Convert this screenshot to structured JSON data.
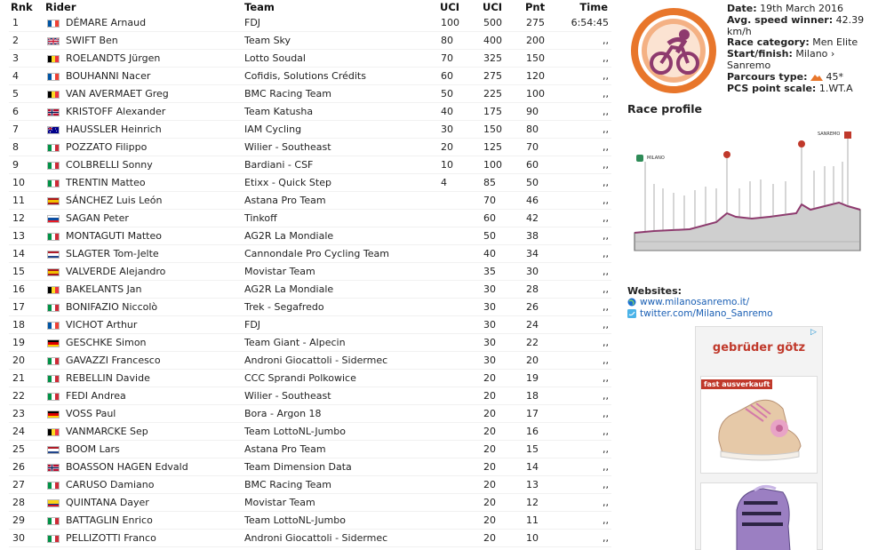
{
  "table": {
    "headers": {
      "rnk": "Rnk",
      "rider": "Rider",
      "team": "Team",
      "uci1": "UCI",
      "uci2": "UCI",
      "pnt": "Pnt",
      "time": "Time"
    },
    "rows": [
      {
        "rnk": "1",
        "flag": "fr",
        "rider": "DÉMARE Arnaud",
        "team": "FDJ",
        "uci1": "100",
        "uci2": "500",
        "pnt": "275",
        "time": "6:54:45"
      },
      {
        "rnk": "2",
        "flag": "gb",
        "rider": "SWIFT Ben",
        "team": "Team Sky",
        "uci1": "80",
        "uci2": "400",
        "pnt": "200",
        "time": ",,"
      },
      {
        "rnk": "3",
        "flag": "be",
        "rider": "ROELANDTS Jürgen",
        "team": "Lotto Soudal",
        "uci1": "70",
        "uci2": "325",
        "pnt": "150",
        "time": ",,"
      },
      {
        "rnk": "4",
        "flag": "fr",
        "rider": "BOUHANNI Nacer",
        "team": "Cofidis, Solutions Crédits",
        "uci1": "60",
        "uci2": "275",
        "pnt": "120",
        "time": ",,"
      },
      {
        "rnk": "5",
        "flag": "be",
        "rider": "VAN AVERMAET Greg",
        "team": "BMC Racing Team",
        "uci1": "50",
        "uci2": "225",
        "pnt": "100",
        "time": ",,"
      },
      {
        "rnk": "6",
        "flag": "no",
        "rider": "KRISTOFF Alexander",
        "team": "Team Katusha",
        "uci1": "40",
        "uci2": "175",
        "pnt": "90",
        "time": ",,"
      },
      {
        "rnk": "7",
        "flag": "au",
        "rider": "HAUSSLER Heinrich",
        "team": "IAM Cycling",
        "uci1": "30",
        "uci2": "150",
        "pnt": "80",
        "time": ",,"
      },
      {
        "rnk": "8",
        "flag": "it",
        "rider": "POZZATO Filippo",
        "team": "Wilier - Southeast",
        "uci1": "20",
        "uci2": "125",
        "pnt": "70",
        "time": ",,"
      },
      {
        "rnk": "9",
        "flag": "it",
        "rider": "COLBRELLI Sonny",
        "team": "Bardiani - CSF",
        "uci1": "10",
        "uci2": "100",
        "pnt": "60",
        "time": ",,"
      },
      {
        "rnk": "10",
        "flag": "it",
        "rider": "TRENTIN Matteo",
        "team": "Etixx - Quick Step",
        "uci1": "4",
        "uci2": "85",
        "pnt": "50",
        "time": ",,"
      },
      {
        "rnk": "11",
        "flag": "es",
        "rider": "SÁNCHEZ Luis León",
        "team": "Astana Pro Team",
        "uci1": "",
        "uci2": "70",
        "pnt": "46",
        "time": ",,"
      },
      {
        "rnk": "12",
        "flag": "sk",
        "rider": "SAGAN Peter",
        "team": "Tinkoff",
        "uci1": "",
        "uci2": "60",
        "pnt": "42",
        "time": ",,"
      },
      {
        "rnk": "13",
        "flag": "it",
        "rider": "MONTAGUTI Matteo",
        "team": "AG2R La Mondiale",
        "uci1": "",
        "uci2": "50",
        "pnt": "38",
        "time": ",,"
      },
      {
        "rnk": "14",
        "flag": "nl",
        "rider": "SLAGTER Tom-Jelte",
        "team": "Cannondale Pro Cycling Team",
        "uci1": "",
        "uci2": "40",
        "pnt": "34",
        "time": ",,"
      },
      {
        "rnk": "15",
        "flag": "es",
        "rider": "VALVERDE Alejandro",
        "team": "Movistar Team",
        "uci1": "",
        "uci2": "35",
        "pnt": "30",
        "time": ",,"
      },
      {
        "rnk": "16",
        "flag": "be",
        "rider": "BAKELANTS Jan",
        "team": "AG2R La Mondiale",
        "uci1": "",
        "uci2": "30",
        "pnt": "28",
        "time": ",,"
      },
      {
        "rnk": "17",
        "flag": "it",
        "rider": "BONIFAZIO Niccolò",
        "team": "Trek - Segafredo",
        "uci1": "",
        "uci2": "30",
        "pnt": "26",
        "time": ",,"
      },
      {
        "rnk": "18",
        "flag": "fr",
        "rider": "VICHOT Arthur",
        "team": "FDJ",
        "uci1": "",
        "uci2": "30",
        "pnt": "24",
        "time": ",,"
      },
      {
        "rnk": "19",
        "flag": "de",
        "rider": "GESCHKE Simon",
        "team": "Team Giant - Alpecin",
        "uci1": "",
        "uci2": "30",
        "pnt": "22",
        "time": ",,"
      },
      {
        "rnk": "20",
        "flag": "it",
        "rider": "GAVAZZI Francesco",
        "team": "Androni Giocattoli - Sidermec",
        "uci1": "",
        "uci2": "30",
        "pnt": "20",
        "time": ",,"
      },
      {
        "rnk": "21",
        "flag": "it",
        "rider": "REBELLIN Davide",
        "team": "CCC Sprandi Polkowice",
        "uci1": "",
        "uci2": "20",
        "pnt": "19",
        "time": ",,"
      },
      {
        "rnk": "22",
        "flag": "it",
        "rider": "FEDI Andrea",
        "team": "Wilier - Southeast",
        "uci1": "",
        "uci2": "20",
        "pnt": "18",
        "time": ",,"
      },
      {
        "rnk": "23",
        "flag": "de",
        "rider": "VOSS Paul",
        "team": "Bora - Argon 18",
        "uci1": "",
        "uci2": "20",
        "pnt": "17",
        "time": ",,"
      },
      {
        "rnk": "24",
        "flag": "be",
        "rider": "VANMARCKE Sep",
        "team": "Team LottoNL-Jumbo",
        "uci1": "",
        "uci2": "20",
        "pnt": "16",
        "time": ",,"
      },
      {
        "rnk": "25",
        "flag": "nl",
        "rider": "BOOM Lars",
        "team": "Astana Pro Team",
        "uci1": "",
        "uci2": "20",
        "pnt": "15",
        "time": ",,"
      },
      {
        "rnk": "26",
        "flag": "no",
        "rider": "BOASSON HAGEN Edvald",
        "team": "Team Dimension Data",
        "uci1": "",
        "uci2": "20",
        "pnt": "14",
        "time": ",,"
      },
      {
        "rnk": "27",
        "flag": "it",
        "rider": "CARUSO Damiano",
        "team": "BMC Racing Team",
        "uci1": "",
        "uci2": "20",
        "pnt": "13",
        "time": ",,"
      },
      {
        "rnk": "28",
        "flag": "co",
        "rider": "QUINTANA Dayer",
        "team": "Movistar Team",
        "uci1": "",
        "uci2": "20",
        "pnt": "12",
        "time": ",,"
      },
      {
        "rnk": "29",
        "flag": "it",
        "rider": "BATTAGLIN Enrico",
        "team": "Team LottoNL-Jumbo",
        "uci1": "",
        "uci2": "20",
        "pnt": "11",
        "time": ",,"
      },
      {
        "rnk": "30",
        "flag": "it",
        "rider": "PELLIZOTTI Franco",
        "team": "Androni Giocattoli - Sidermec",
        "uci1": "",
        "uci2": "20",
        "pnt": "10",
        "time": ",,"
      }
    ]
  },
  "flags": {
    "fr": {
      "dir": "v",
      "colors": [
        "#0055a4",
        "#ffffff",
        "#ef4135"
      ]
    },
    "it": {
      "dir": "v",
      "colors": [
        "#009246",
        "#ffffff",
        "#ce2b37"
      ]
    },
    "be": {
      "dir": "v",
      "colors": [
        "#000000",
        "#fdda24",
        "#ef3340"
      ]
    },
    "de": {
      "dir": "h",
      "colors": [
        "#000000",
        "#dd0000",
        "#ffce00"
      ]
    },
    "nl": {
      "dir": "h",
      "colors": [
        "#ae1c28",
        "#ffffff",
        "#21468b"
      ]
    },
    "es": {
      "dir": "h",
      "colors": [
        "#aa151b",
        "#f1bf00",
        "#f1bf00",
        "#aa151b"
      ]
    },
    "co": {
      "dir": "h",
      "colors": [
        "#fcd116",
        "#fcd116",
        "#003893",
        "#ce1126"
      ]
    },
    "sk": {
      "dir": "h",
      "colors": [
        "#ffffff",
        "#0b4ea2",
        "#ee1c25"
      ]
    },
    "gb": {
      "dir": "special",
      "colors": [
        "#012169",
        "#c8102e",
        "#ffffff"
      ]
    },
    "no": {
      "dir": "special",
      "colors": [
        "#ba0c2f",
        "#00205b",
        "#ffffff"
      ]
    },
    "au": {
      "dir": "special",
      "colors": [
        "#00008b",
        "#ffffff",
        "#cc0000"
      ]
    }
  },
  "race_info": {
    "date_label": "Date:",
    "date_value": "19th March 2016",
    "speed_label": "Avg. speed winner:",
    "speed_value": "42.39 km/h",
    "category_label": "Race category:",
    "category_value": "Men Elite",
    "startfinish_label": "Start/finish:",
    "startfinish_value": "Milano › Sanremo",
    "parcours_label": "Parcours type:",
    "parcours_value": "45*",
    "pcs_label": "PCS point scale:",
    "pcs_value": "1.WT.A"
  },
  "profile": {
    "title": "Race profile",
    "start_label": "MILANO",
    "finish_label": "SANREMO"
  },
  "websites": {
    "title": "Websites:",
    "link1": "www.milanosanremo.it/",
    "link2": "twitter.com/Milano_Sanremo"
  },
  "ad": {
    "brand": "gebrüder götz",
    "badge": "fast ausverkauft"
  },
  "colors": {
    "logo_ring": "#e8762b",
    "logo_inner": "#8e3a6e",
    "link": "#1a5fb4",
    "ad_red": "#c0392b"
  }
}
